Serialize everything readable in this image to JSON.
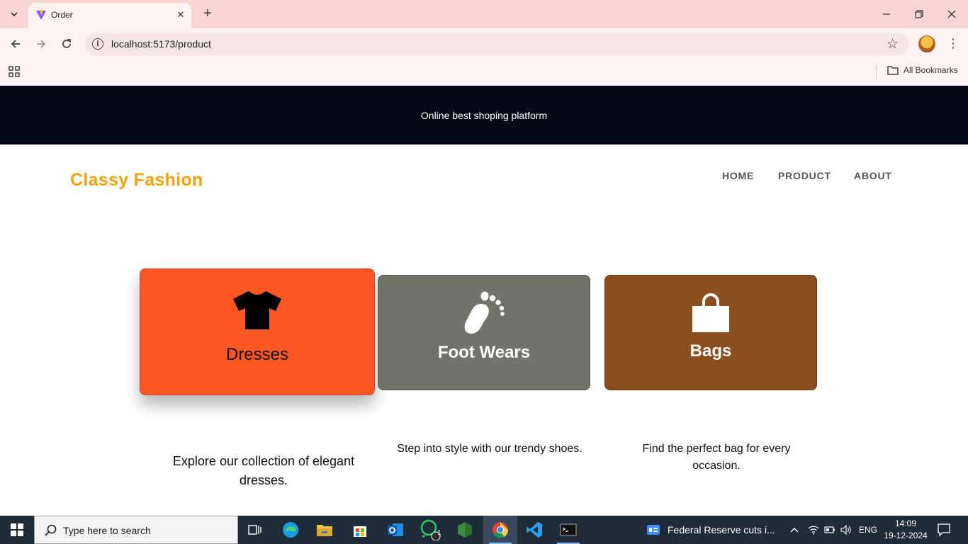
{
  "browser": {
    "tab_title": "Order",
    "url": "localhost:5173/product",
    "bookmarks_folder": "All Bookmarks"
  },
  "site": {
    "banner_text": "Online best shoping platform",
    "brand": "Classy Fashion",
    "brand_color": "#f5a20a",
    "nav": [
      "HOME",
      "PRODUCT",
      "ABOUT"
    ]
  },
  "categories": [
    {
      "label": "Dresses",
      "icon": "tshirt-icon",
      "color": "#ff5722",
      "description": "Explore our collection of elegant dresses."
    },
    {
      "label": "Foot Wears",
      "icon": "footprint-icon",
      "color": "#737369",
      "description": "Step into style with our trendy shoes."
    },
    {
      "label": "Bags",
      "icon": "shopping-bag-icon",
      "color": "#8b4e1f",
      "description": "Find the perfect bag for every occasion."
    }
  ],
  "taskbar": {
    "search_placeholder": "Type here to search",
    "news_text": "Federal Reserve cuts i...",
    "language": "ENG",
    "time": "14:09",
    "date": "19-12-2024",
    "whatsapp_badge": "1"
  }
}
